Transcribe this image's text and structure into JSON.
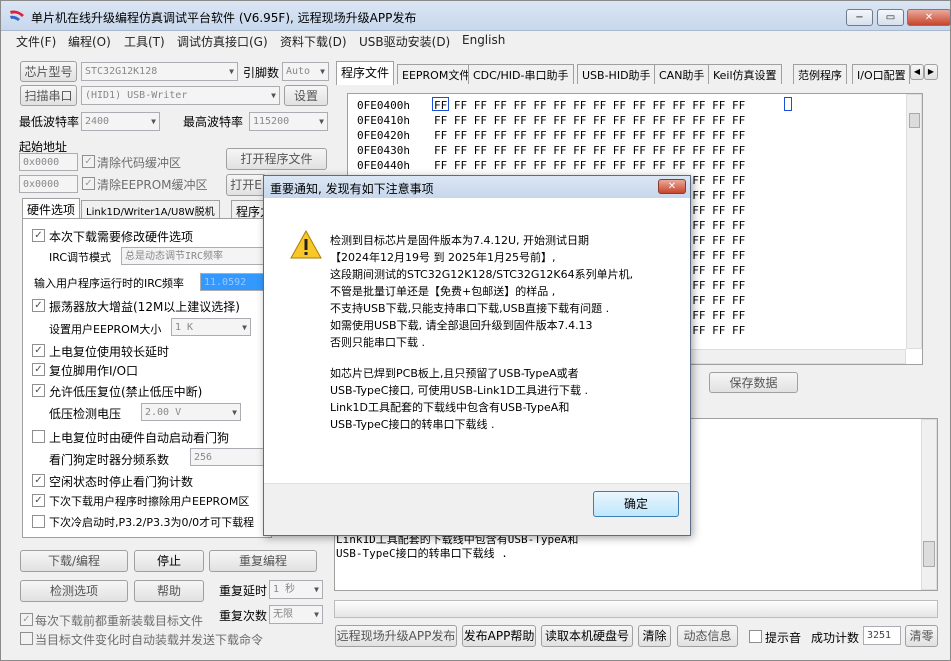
{
  "window": {
    "title": "单片机在线升级编程仿真调试平台软件 (V6.95F), 远程现场升级APP发布",
    "min": "−",
    "max": "▭",
    "close": "✕"
  },
  "menu": [
    "文件(F)",
    "编程(O)",
    "工具(T)",
    "调试仿真接口(G)",
    "资料下载(D)",
    "USB驱动安装(D)",
    "English"
  ],
  "left": {
    "chip_model_btn": "芯片型号",
    "chip_model": "STC32G12K128",
    "pin_label": "引脚数",
    "pin_value": "Auto",
    "scan_port_btn": "扫描串口",
    "port_value": "(HID1) USB-Writer",
    "settings_btn": "设置",
    "min_baud_label": "最低波特率",
    "min_baud": "2400",
    "max_baud_label": "最高波特率",
    "max_baud": "115200",
    "start_addr_label": "起始地址",
    "addr1": "0x0000",
    "clear_code_buf": "清除代码缓冲区",
    "open_prog_btn": "打开程序文件",
    "addr2": "0x0000",
    "clear_eeprom_buf": "清除EEPROM缓冲区",
    "open_eeprom_btn": "打开E",
    "tabs": [
      "硬件选项",
      "Link1D/Writer1A/U8W脱机",
      "程序力"
    ],
    "options": {
      "need_modify": "本次下载需要修改硬件选项",
      "irc_label": "IRC调节模式",
      "irc_value": "总是动态调节IRC频率",
      "irc_freq_label": "输入用户程序运行时的IRC频率",
      "irc_freq_value": "11.0592",
      "osc_gain": "振荡器放大增益(12M以上建议选择)",
      "eeprom_size_label": "设置用户EEPROM大小",
      "eeprom_size": "1  K",
      "long_delay": "上电复位使用较长延时",
      "reset_io": "复位脚用作I/O口",
      "lvr": "允许低压复位(禁止低压中断)",
      "lv_label": "低压检测电压",
      "lv_value": "2.00 V",
      "wdt_auto": "上电复位时由硬件自动启动看门狗",
      "wdt_div_label": "看门狗定时器分频系数",
      "wdt_div": "256",
      "idle_stop_wdt": "空闲状态时停止看门狗计数",
      "erase_eeprom": "下次下载用户程序时擦除用户EEPROM区",
      "p32_p33": "下次冷启动时,P3.2/P3.3为0/0才可下载程"
    },
    "download_btn": "下载/编程",
    "stop_btn": "停止",
    "reprogram_btn": "重复编程",
    "detect_btn": "检测选项",
    "help_btn": "帮助",
    "repeat_delay_label": "重复延时",
    "repeat_delay": "1 秒",
    "repeat_count_label": "重复次数",
    "repeat_count": "无限",
    "reload_each": "每次下载前都重新装载目标文件",
    "auto_reload": "当目标文件变化时自动装载并发送下载命令"
  },
  "right": {
    "tabs": [
      "程序文件",
      "EEPROM文件",
      "CDC/HID-串口助手",
      "USB-HID助手",
      "CAN助手",
      "Keil仿真设置",
      "范例程序",
      "I/O口配置"
    ],
    "hex_rows": [
      {
        "addr": "0FE0400h",
        "data": "FF FF FF FF FF FF FF FF FF FF FF FF FF FF FF FF"
      },
      {
        "addr": "0FE0410h",
        "data": "FF FF FF FF FF FF FF FF FF FF FF FF FF FF FF FF"
      },
      {
        "addr": "0FE0420h",
        "data": "FF FF FF FF FF FF FF FF FF FF FF FF FF FF FF FF"
      },
      {
        "addr": "0FE0430h",
        "data": "FF FF FF FF FF FF FF FF FF FF FF FF FF FF FF FF"
      },
      {
        "addr": "0FE0440h",
        "data": "FF FF FF FF FF FF FF FF FF FF FF FF FF FF FF FF"
      },
      {
        "addr": "",
        "data": "FF FF FF FF FF FF FF FF FF FF FF FF FF FF FF FF"
      },
      {
        "addr": "",
        "data": "FF FF FF FF FF FF FF FF FF FF FF FF FF FF FF FF"
      },
      {
        "addr": "",
        "data": "FF FF FF FF FF FF FF FF FF FF FF FF FF FF FF FF"
      },
      {
        "addr": "",
        "data": "FF FF FF FF FF FF FF FF FF FF FF FF FF FF FF FF"
      },
      {
        "addr": "",
        "data": "FF FF FF FF FF FF FF FF FF FF FF FF FF FF FF FF"
      },
      {
        "addr": "",
        "data": "FF FF FF FF FF FF FF FF FF FF FF FF FF FF FF FF"
      },
      {
        "addr": "",
        "data": "FF FF FF FF FF FF FF FF FF FF FF FF FF FF FF FF"
      },
      {
        "addr": "",
        "data": "FF FF FF FF FF FF FF FF FF FF FF FF FF FF FF FF"
      },
      {
        "addr": "",
        "data": "FF FF FF FF FF FF FF FF FF FF FF FF FF FF FF FF"
      },
      {
        "addr": "",
        "data": "FF FF FF FF FF FF FF FF FF FF FF FF FF FF FF FF"
      },
      {
        "addr": "",
        "data": "FF FF FF FF FF FF FF FF FF FF FF FF FF FF FF FF"
      }
    ],
    "save_data_btn": "保存数据",
    "log_lines": [
      "Link1D工具配套的下载线中包含有USB-TypeA和",
      "USB-TypeC接口的转串口下载线 ."
    ],
    "upgrade_app_btn": "远程现场升级APP发布",
    "publish_help_btn": "发布APP帮助",
    "read_disk_btn": "读取本机硬盘号",
    "clear_btn": "清除",
    "anim_btn": "动态信息",
    "beep_label": "提示音",
    "success_label": "成功计数",
    "success_count": "3251",
    "reset_btn": "清零"
  },
  "dialog": {
    "title": "重要通知, 发现有如下注意事项",
    "close": "✕",
    "lines": [
      "检测到目标芯片是固件版本为7.4.12U, 开始测试日期",
      "【2024年12月19号 到 2025年1月25号前】,",
      "这段期间测试的STC32G12K128/STC32G12K64系列单片机,",
      "不管是批量订单还是【免费+包邮送】的样品 ,",
      "不支持USB下载,只能支持串口下载,USB直接下载有问题 .",
      "如需使用USB下载, 请全部退回升级到固件版本7.4.13",
      "否则只能串口下载 ."
    ],
    "lines2": [
      "如芯片已焊到PCB板上,且只预留了USB-TypeA或者",
      "USB-TypeC接口, 可使用USB-Link1D工具进行下载 .",
      "Link1D工具配套的下载线中包含有USB-TypeA和",
      "USB-TypeC接口的转串口下载线 ."
    ],
    "ok": "确定"
  }
}
